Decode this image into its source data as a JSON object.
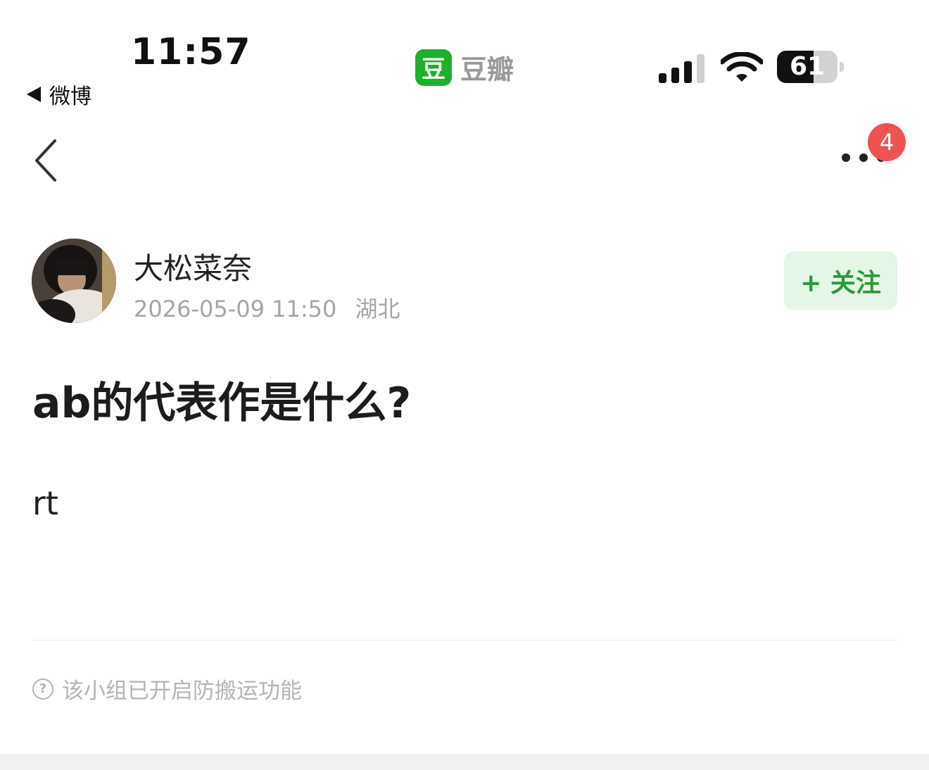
{
  "status_bar": {
    "time": "11:57",
    "back_app": "微博",
    "app_name": "豆瓣",
    "app_logo_char": "豆",
    "battery_level": 61,
    "battery_text": "61",
    "signal_bars": 3
  },
  "nav": {
    "notification_count": "4"
  },
  "author": {
    "name": "大松菜奈",
    "date": "2026-05-09 11:50",
    "location": "湖北",
    "follow_label": "+ 关注"
  },
  "post": {
    "title": "ab的代表作是什么?",
    "body": "rt"
  },
  "footer": {
    "notice": "该小组已开启防搬运功能",
    "notice_icon": "question-icon"
  },
  "colors": {
    "accent_green": "#2a9a3a",
    "follow_bg": "#e4f6e6",
    "badge_red": "#f05252",
    "logo_green": "#1db02a"
  }
}
